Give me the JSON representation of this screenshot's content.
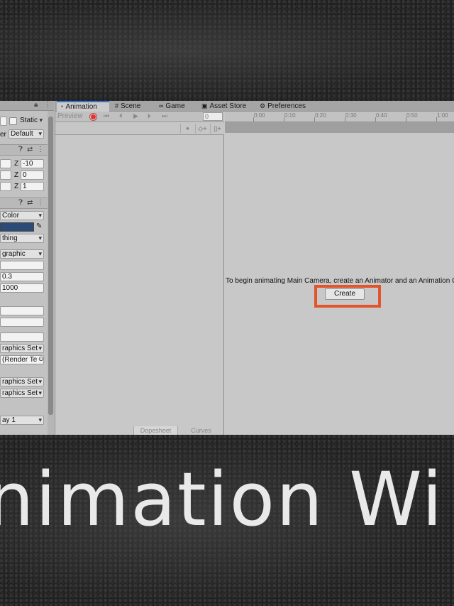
{
  "banner": {
    "text": "nimation Wi"
  },
  "tabs": [
    {
      "label": "Animation",
      "icon": "◔"
    },
    {
      "label": "Scene",
      "icon": "#"
    },
    {
      "label": "Game",
      "icon": "∞"
    },
    {
      "label": "Asset Store",
      "icon": "▣"
    },
    {
      "label": "Preferences",
      "icon": "⚙"
    }
  ],
  "animation": {
    "preview_label": "Preview",
    "frame_value": "0",
    "ruler_ticks": [
      "0:00",
      "0:10",
      "0:20",
      "0:30",
      "0:40",
      "0:50",
      "1:00"
    ],
    "message": "To begin animating Main Camera, create an Animator and an Animation C",
    "create_label": "Create",
    "bottom_tabs": [
      "Dopesheet",
      "Curves"
    ],
    "highlight_color": "#e2542b"
  },
  "inspector": {
    "static_label": "Static",
    "layer_label": "er",
    "layer_value": "Default",
    "pos_z_label": "Z",
    "pos_z": "-10",
    "rot_z_label": "Z",
    "rot_z": "0",
    "scale_z_label": "Z",
    "scale_z": "1",
    "clear_flags": "Color",
    "culling_mask": "thing",
    "projection": "graphic",
    "near_clip": "0.3",
    "far_clip": "1000",
    "graphics_set_1": "raphics Set",
    "render_texture": "(Render Te",
    "graphics_set_2": "raphics Set",
    "graphics_set_3": "raphics Set",
    "target_display": "ay 1",
    "background_color": "#2b4a78"
  }
}
